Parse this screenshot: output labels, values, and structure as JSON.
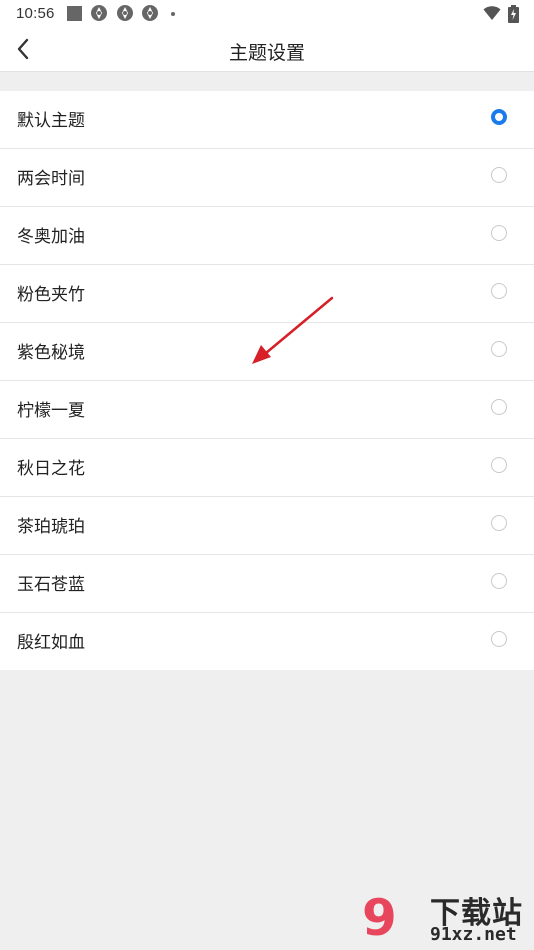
{
  "status_bar": {
    "time": "10:56"
  },
  "nav": {
    "title": "主题设置"
  },
  "themes": [
    {
      "label": "默认主题",
      "selected": true
    },
    {
      "label": "两会时间",
      "selected": false
    },
    {
      "label": "冬奥加油",
      "selected": false
    },
    {
      "label": "粉色夹竹",
      "selected": false
    },
    {
      "label": "紫色秘境",
      "selected": false
    },
    {
      "label": "柠檬一夏",
      "selected": false
    },
    {
      "label": "秋日之花",
      "selected": false
    },
    {
      "label": "茶珀琥珀",
      "selected": false
    },
    {
      "label": "玉石苍蓝",
      "selected": false
    },
    {
      "label": "殷红如血",
      "selected": false
    }
  ],
  "watermark": {
    "logo": "9",
    "title": "下载站",
    "url": "91xz.net"
  },
  "colors": {
    "accent": "#1a7bee",
    "annotation": "#d61f26",
    "watermark_red": "#e8344e"
  }
}
